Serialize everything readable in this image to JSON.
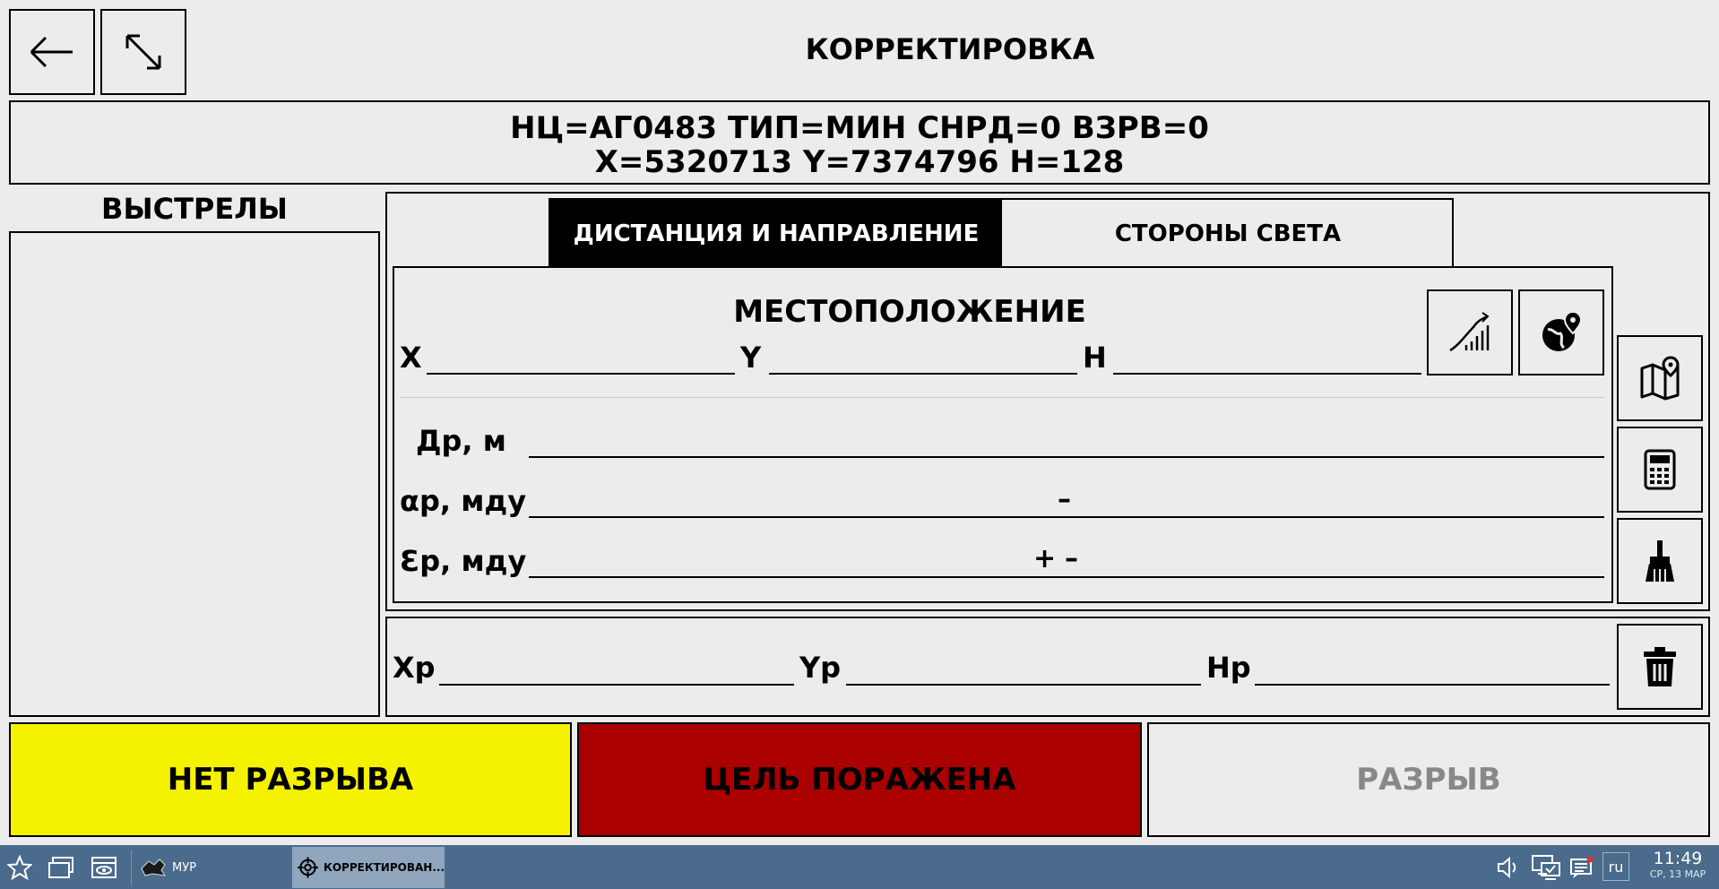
{
  "header": {
    "title": "КОРРЕКТИРОВКА",
    "info_line1": "НЦ=АГ0483 ТИП=МИН СНРД=0 ВЗРВ=0",
    "info_line2": "X=5320713 Y=7374796 H=128"
  },
  "shots": {
    "title": "ВЫСТРЕЛЫ",
    "items": []
  },
  "tabs": [
    {
      "label": "ДИСТАНЦИЯ И НАПРАВЛЕНИЕ",
      "active": true
    },
    {
      "label": "СТОРОНЫ СВЕТА",
      "active": false
    }
  ],
  "location": {
    "title": "МЕСТОПОЛОЖЕНИЕ",
    "x_label": "X",
    "y_label": "Y",
    "h_label": "H",
    "x_value": "",
    "y_value": "",
    "h_value": ""
  },
  "params": {
    "dr_label": "Др, м",
    "ar_label": "αр, мду",
    "er_label": "Ɛр, мду",
    "dr_value": "",
    "ar_sign_minus": "–",
    "er_sign_plus": "+",
    "er_sign_minus": "–"
  },
  "result": {
    "xr_label": "Xр",
    "yr_label": "Yр",
    "hr_label": "Hр",
    "xr_value": "",
    "yr_value": "",
    "hr_value": ""
  },
  "actions": {
    "no_burst": "НЕТ РАЗРЫВА",
    "target_hit": "ЦЕЛЬ ПОРАЖЕНА",
    "burst": "РАЗРЫВ"
  },
  "colors": {
    "no_burst_bg": "#f5f200",
    "target_hit_bg": "#aa0000",
    "burst_text": "#888888",
    "taskbar_bg": "#4a6b8c",
    "active_tab_bg": "#000000"
  },
  "taskbar": {
    "app1_label": "МУР",
    "app2_label": "КОРРЕКТИРОВАН...",
    "lang": "ru",
    "time": "11:49",
    "date": "СР, 13 МАР"
  }
}
